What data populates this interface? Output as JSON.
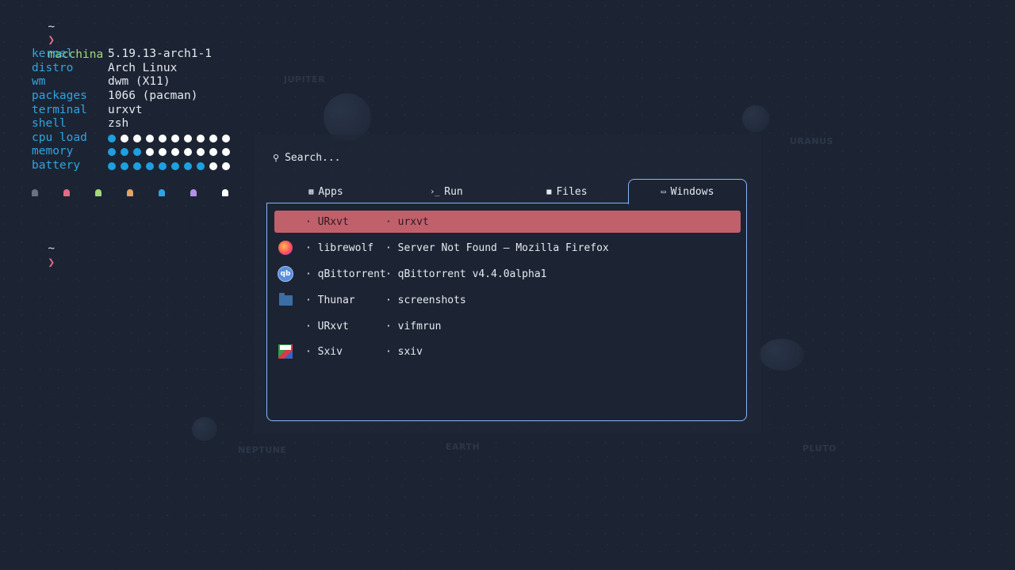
{
  "terminal": {
    "prompt_tilde": "~",
    "prompt_chevron": "❯",
    "command": "macchina",
    "info": [
      {
        "key": "kernel",
        "value": "5.19.13-arch1-1"
      },
      {
        "key": "distro",
        "value": "Arch Linux"
      },
      {
        "key": "wm",
        "value": "dwm (X11)"
      },
      {
        "key": "packages",
        "value": "1066 (pacman)"
      },
      {
        "key": "terminal",
        "value": "urxvt"
      },
      {
        "key": "shell",
        "value": "zsh"
      },
      {
        "key": "cpu load",
        "bar_filled": 1,
        "bar_total": 10
      },
      {
        "key": "memory",
        "bar_filled": 3,
        "bar_total": 10
      },
      {
        "key": "battery",
        "bar_filled": 8,
        "bar_total": 10
      }
    ],
    "ghost_colors": [
      "#6b7280",
      "#e06c88",
      "#a3d977",
      "#e0a46c",
      "#2fa4e0",
      "#b48ee8",
      "#ffffff"
    ],
    "second_prompt_tilde": "~",
    "second_prompt_chevron": "❯"
  },
  "wallpaper": {
    "labels": [
      "JUPITER",
      "URANUS",
      "NEPTUNE",
      "EARTH",
      "PLUTO"
    ]
  },
  "launcher": {
    "search_placeholder": "Search...",
    "search_icon": "search-icon",
    "tabs": [
      {
        "label": "Apps",
        "icon": "grid-icon",
        "glyph": "▪"
      },
      {
        "label": "Run",
        "icon": "terminal-prompt-icon",
        "glyph": "›_"
      },
      {
        "label": "Files",
        "icon": "folder-icon",
        "glyph": "■"
      },
      {
        "label": "Windows",
        "icon": "window-icon",
        "glyph": "▭",
        "active": true
      }
    ],
    "windows": [
      {
        "class": "· URxvt",
        "title": "· urxvt",
        "icon": "none",
        "selected": true
      },
      {
        "class": "· librewolf",
        "title": "· Server Not Found — Mozilla Firefox",
        "icon": "firefox-icon"
      },
      {
        "class": "· qBittorrent",
        "title": "· qBittorrent v4.4.0alpha1",
        "icon": "qbittorrent-icon",
        "icon_text": "qb"
      },
      {
        "class": "· Thunar",
        "title": "· screenshots",
        "icon": "folder-icon"
      },
      {
        "class": "· URxvt",
        "title": "· vifmrun",
        "icon": "none"
      },
      {
        "class": "· Sxiv",
        "title": "· sxiv",
        "icon": "sxiv-icon"
      }
    ],
    "colors": {
      "accent_border": "#89b4fa",
      "selected_row": "#c0606b"
    }
  }
}
